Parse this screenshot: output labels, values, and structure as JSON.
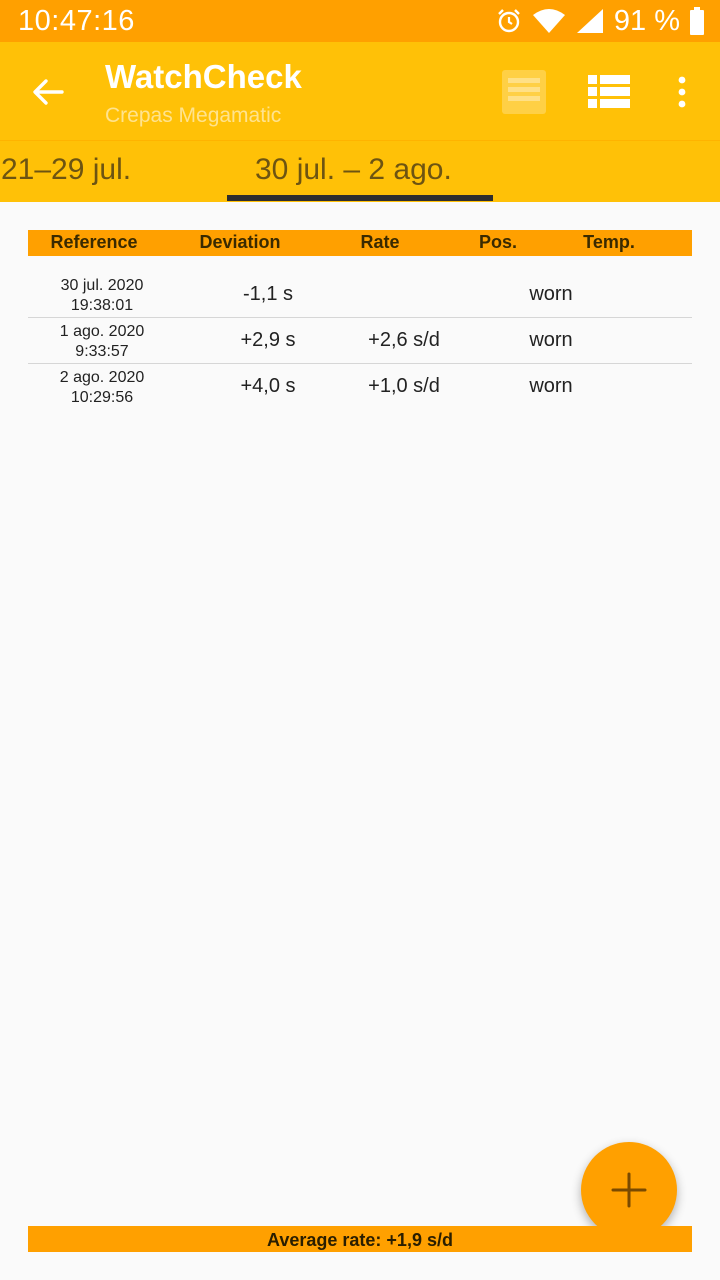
{
  "status_bar": {
    "time": "10:47:16",
    "battery": "91 %",
    "icons": [
      "alarm-icon",
      "wifi-icon",
      "signal-icon",
      "battery-icon"
    ]
  },
  "toolbar": {
    "title": "WatchCheck",
    "subtitle": "Crepas Megamatic",
    "icons": [
      "back-arrow-icon",
      "list-view-icon",
      "table-view-icon",
      "more-vert-icon"
    ]
  },
  "tabs": {
    "previous": "21–29 jul.",
    "current": "30 jul. – 2 ago."
  },
  "table": {
    "headers": {
      "reference": "Reference",
      "deviation": "Deviation",
      "rate": "Rate",
      "position": "Pos.",
      "temperature": "Temp."
    },
    "rows": [
      {
        "date": "30 jul. 2020",
        "time": "19:38:01",
        "deviation": "-1,1 s",
        "rate": "",
        "temp": "worn"
      },
      {
        "date": "1 ago. 2020",
        "time": "9:33:57",
        "deviation": "+2,9 s",
        "rate": "+2,6 s/d",
        "temp": "worn"
      },
      {
        "date": "2 ago. 2020",
        "time": "10:29:56",
        "deviation": "+4,0 s",
        "rate": "+1,0 s/d",
        "temp": "worn"
      }
    ]
  },
  "footer": {
    "average": "Average rate: +1,9 s/d"
  },
  "fab": {
    "icon": "plus-icon"
  },
  "colors": {
    "status_bar": "#ffa000",
    "toolbar": "#ffc107",
    "accent": "#ffa000",
    "tab_indicator": "#2e2e2e"
  }
}
